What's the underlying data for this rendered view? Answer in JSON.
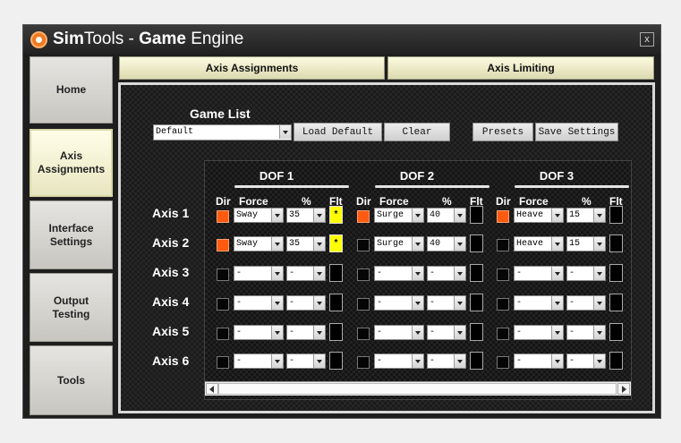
{
  "window": {
    "title_brand": "Sim",
    "title_brand_rest": "Tools",
    "title_sep": " - ",
    "title_app": "Game",
    "title_app_rest": " Engine",
    "close_label": "x"
  },
  "sidebar": {
    "items": [
      {
        "label": "Home",
        "active": false
      },
      {
        "label": "Axis\nAssignments",
        "active": true
      },
      {
        "label": "Interface\nSettings",
        "active": false
      },
      {
        "label": "Output\nTesting",
        "active": false
      },
      {
        "label": "Tools",
        "active": false
      }
    ]
  },
  "tabs": [
    {
      "label": "Axis Assignments"
    },
    {
      "label": "Axis Limiting"
    }
  ],
  "game_list": {
    "label": "Game List",
    "selected": "Default"
  },
  "buttons": {
    "load_default": "Load Default",
    "clear": "Clear",
    "presets": "Presets",
    "save_settings": "Save Settings"
  },
  "dofs": [
    {
      "title": "DOF 1"
    },
    {
      "title": "DOF 2"
    },
    {
      "title": "DOF 3"
    }
  ],
  "column_headers": {
    "dir": "Dir",
    "force": "Force",
    "percent": "%",
    "flt": "Flt"
  },
  "axes": [
    {
      "label": "Axis 1",
      "dofs": [
        {
          "dir": true,
          "force": "Sway",
          "percent": "35",
          "flt": true,
          "flt_text": "*"
        },
        {
          "dir": true,
          "force": "Surge",
          "percent": "40",
          "flt": false,
          "flt_text": ""
        },
        {
          "dir": true,
          "force": "Heave",
          "percent": "15",
          "flt": false,
          "flt_text": ""
        }
      ]
    },
    {
      "label": "Axis 2",
      "dofs": [
        {
          "dir": true,
          "force": "Sway",
          "percent": "35",
          "flt": true,
          "flt_text": "*"
        },
        {
          "dir": false,
          "force": "Surge",
          "percent": "40",
          "flt": false,
          "flt_text": ""
        },
        {
          "dir": false,
          "force": "Heave",
          "percent": "15",
          "flt": false,
          "flt_text": ""
        }
      ]
    },
    {
      "label": "Axis 3",
      "dofs": [
        {
          "dir": false,
          "force": "-",
          "percent": "-",
          "flt": false,
          "flt_text": ""
        },
        {
          "dir": false,
          "force": "-",
          "percent": "-",
          "flt": false,
          "flt_text": ""
        },
        {
          "dir": false,
          "force": "-",
          "percent": "-",
          "flt": false,
          "flt_text": ""
        }
      ]
    },
    {
      "label": "Axis 4",
      "dofs": [
        {
          "dir": false,
          "force": "-",
          "percent": "-",
          "flt": false,
          "flt_text": ""
        },
        {
          "dir": false,
          "force": "-",
          "percent": "-",
          "flt": false,
          "flt_text": ""
        },
        {
          "dir": false,
          "force": "-",
          "percent": "-",
          "flt": false,
          "flt_text": ""
        }
      ]
    },
    {
      "label": "Axis 5",
      "dofs": [
        {
          "dir": false,
          "force": "-",
          "percent": "-",
          "flt": false,
          "flt_text": ""
        },
        {
          "dir": false,
          "force": "-",
          "percent": "-",
          "flt": false,
          "flt_text": ""
        },
        {
          "dir": false,
          "force": "-",
          "percent": "-",
          "flt": false,
          "flt_text": ""
        }
      ]
    },
    {
      "label": "Axis 6",
      "dofs": [
        {
          "dir": false,
          "force": "-",
          "percent": "-",
          "flt": false,
          "flt_text": ""
        },
        {
          "dir": false,
          "force": "-",
          "percent": "-",
          "flt": false,
          "flt_text": ""
        },
        {
          "dir": false,
          "force": "-",
          "percent": "-",
          "flt": false,
          "flt_text": ""
        }
      ]
    }
  ],
  "colors": {
    "accent_orange": "#ff5a10",
    "flt_active": "#ffff00",
    "tab_bg": "#fdfbe0",
    "panel_bg": "#1b1b1b"
  }
}
